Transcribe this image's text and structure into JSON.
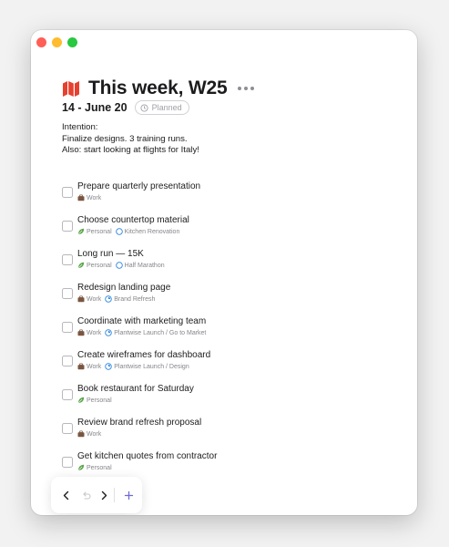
{
  "colors": {
    "accent": "#e8402f",
    "plus": "#6e6bd4",
    "project_ring": "#2a86e0",
    "personal_leaf": "#5aa84a",
    "work_case": "#7a5540"
  },
  "window": {
    "traffic_lights": [
      "close",
      "minimize",
      "zoom"
    ]
  },
  "header": {
    "icon": "map-icon",
    "title": "This week, W25",
    "more_icon": "ellipsis-icon"
  },
  "date_range": "14 - June 20",
  "status_badge": {
    "label": "Planned",
    "icon": "clock-icon"
  },
  "intention": {
    "lines": [
      "Intention:",
      "Finalize designs. 3 training runs.",
      "Also: start looking at flights for Italy!"
    ]
  },
  "tasks": [
    {
      "title": "Prepare quarterly presentation",
      "area": "Work",
      "area_icon": "briefcase-icon",
      "project": null
    },
    {
      "title": "Choose countertop material",
      "area": "Personal",
      "area_icon": "leaf-icon",
      "project": "Kitchen Renovation",
      "project_progress": 0
    },
    {
      "title": "Long run — 15K",
      "area": "Personal",
      "area_icon": "leaf-icon",
      "project": "Half Marathon",
      "project_progress": 0
    },
    {
      "title": "Redesign landing page",
      "area": "Work",
      "area_icon": "briefcase-icon",
      "project": "Brand Refresh",
      "project_progress": 0.25
    },
    {
      "title": "Coordinate with marketing team",
      "area": "Work",
      "area_icon": "briefcase-icon",
      "project": "Plantwise Launch / Go to Market",
      "project_progress": 0.25
    },
    {
      "title": "Create wireframes for dashboard",
      "area": "Work",
      "area_icon": "briefcase-icon",
      "project": "Plantwise Launch / Design",
      "project_progress": 0.25
    },
    {
      "title": "Book restaurant for Saturday",
      "area": "Personal",
      "area_icon": "leaf-icon",
      "project": null
    },
    {
      "title": "Review brand refresh proposal",
      "area": "Work",
      "area_icon": "briefcase-icon",
      "project": null
    },
    {
      "title": "Get kitchen quotes from contractor",
      "area": "Personal",
      "area_icon": "leaf-icon",
      "project": null
    }
  ],
  "bottom_bar": {
    "buttons": [
      "chevron-left-icon",
      "redo-icon",
      "chevron-right-icon",
      "plus-icon"
    ]
  }
}
